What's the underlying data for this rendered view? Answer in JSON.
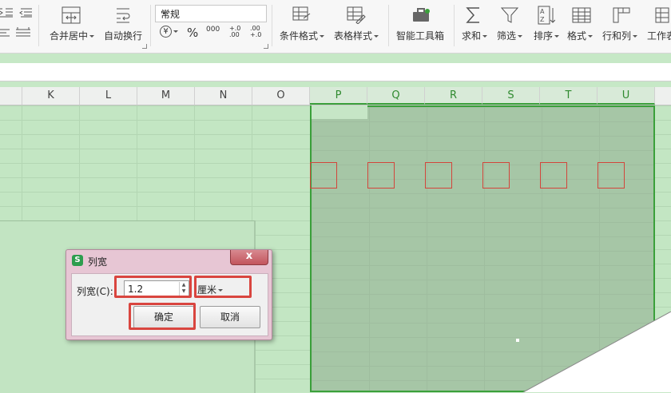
{
  "ribbon": {
    "buttons": [
      {
        "name": "merge-center",
        "label": "合并居中"
      },
      {
        "name": "wrap-text",
        "label": "自动换行"
      },
      {
        "name": "cond-format",
        "label": "条件格式"
      },
      {
        "name": "table-style",
        "label": "表格样式"
      },
      {
        "name": "smart-toolbox",
        "label": "智能工具箱"
      },
      {
        "name": "sum",
        "label": "求和"
      },
      {
        "name": "filter",
        "label": "筛选"
      },
      {
        "name": "sort",
        "label": "排序"
      },
      {
        "name": "format",
        "label": "格式"
      },
      {
        "name": "row-col",
        "label": "行和列"
      },
      {
        "name": "worksheet",
        "label": "工作表"
      }
    ],
    "number_format": "常规",
    "currency_symbol": "¥",
    "percent_symbol": "%",
    "thousands": "000",
    "inc_decimal": "+.0 .00",
    "dec_decimal": ".00 +.0"
  },
  "columns": [
    "K",
    "L",
    "M",
    "N",
    "O",
    "P",
    "Q",
    "R",
    "S",
    "T",
    "U"
  ],
  "selected_columns": [
    "P",
    "Q",
    "R",
    "S",
    "T",
    "U"
  ],
  "dialog": {
    "icon": "S",
    "title": "列宽",
    "close": "x",
    "field_label": "列宽(C):",
    "value": "1.2",
    "unit": "厘米",
    "ok": "确定",
    "cancel": "取消"
  },
  "colors": {
    "selection": "#3aa03a",
    "highlight": "#d9453f"
  }
}
